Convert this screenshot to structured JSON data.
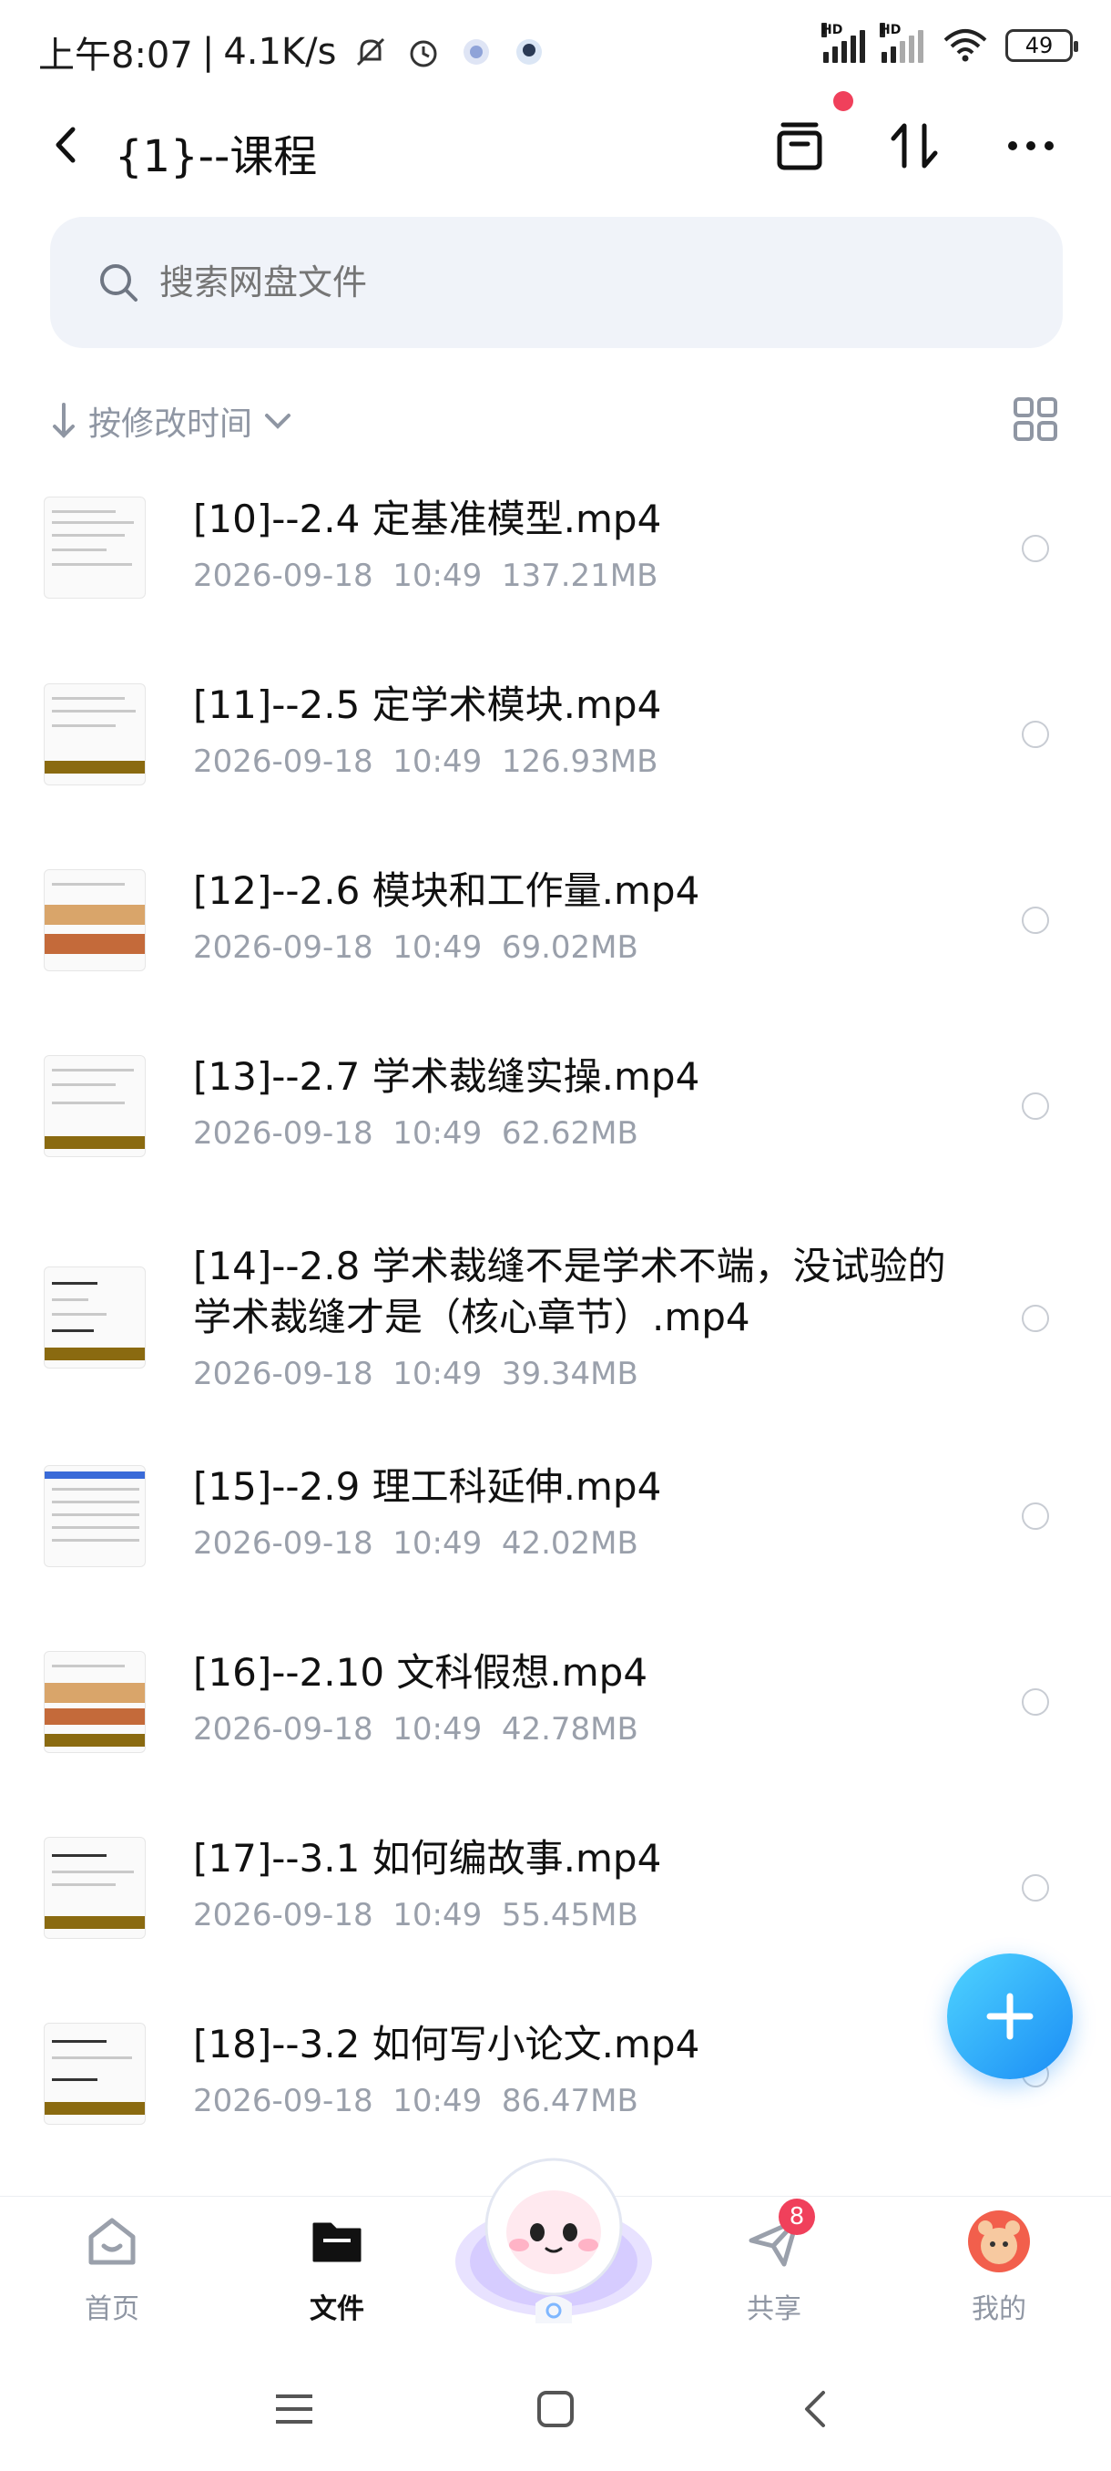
{
  "status_bar": {
    "time": "上午8:07",
    "speed": "4.1K/s",
    "battery": "49",
    "hd1": "HD",
    "hd2": "HD"
  },
  "header": {
    "title": "{1}--课程",
    "back_icon": "chevron-left-icon",
    "archive_icon": "archive-icon",
    "sort_icon": "sort-icon",
    "more_icon": "more-icon"
  },
  "search": {
    "placeholder": "搜索网盘文件"
  },
  "sort": {
    "label": "按修改时间"
  },
  "files": [
    {
      "name": "[10]--2.4 定基准模型.mp4",
      "date": "2026-09-18",
      "time": "10:49",
      "size": "137.21MB"
    },
    {
      "name": "[11]--2.5 定学术模块.mp4",
      "date": "2026-09-18",
      "time": "10:49",
      "size": "126.93MB"
    },
    {
      "name": "[12]--2.6 模块和工作量.mp4",
      "date": "2026-09-18",
      "time": "10:49",
      "size": "69.02MB"
    },
    {
      "name": "[13]--2.7 学术裁缝实操.mp4",
      "date": "2026-09-18",
      "time": "10:49",
      "size": "62.62MB"
    },
    {
      "name_line1": "[14]--2.8 学术裁缝不是学术不端，没试验的",
      "name_line2": "学术裁缝才是（核心章节）.mp4",
      "date": "2026-09-18",
      "time": "10:49",
      "size": "39.34MB"
    },
    {
      "name": "[15]--2.9 理工科延伸.mp4",
      "date": "2026-09-18",
      "time": "10:49",
      "size": "42.02MB"
    },
    {
      "name": "[16]--2.10 文科假想.mp4",
      "date": "2026-09-18",
      "time": "10:49",
      "size": "42.78MB"
    },
    {
      "name": "[17]--3.1 如何编故事.mp4",
      "date": "2026-09-18",
      "time": "10:49",
      "size": "55.45MB"
    },
    {
      "name": "[18]--3.2 如何写小论文.mp4",
      "date": "2026-09-18",
      "time": "10:49",
      "size": "86.47MB"
    }
  ],
  "bottom_nav": {
    "home": "首页",
    "files": "文件",
    "share": "共享",
    "share_badge": "8",
    "me": "我的"
  },
  "colors": {
    "accent": "#1a8cf5",
    "badge": "#f0405b",
    "muted": "#9aa0ab"
  }
}
